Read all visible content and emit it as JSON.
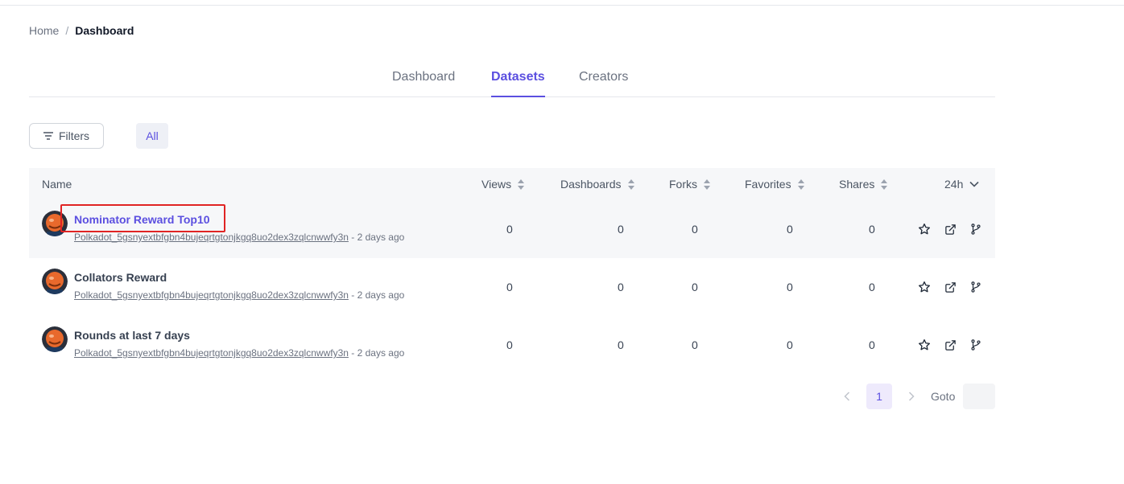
{
  "breadcrumb": {
    "home": "Home",
    "separator": "/",
    "current": "Dashboard"
  },
  "tabs": [
    {
      "label": "Dashboard",
      "active": false
    },
    {
      "label": "Datasets",
      "active": true
    },
    {
      "label": "Creators",
      "active": false
    }
  ],
  "toolbar": {
    "filters_label": "Filters",
    "all_label": "All"
  },
  "table": {
    "columns": {
      "name": "Name",
      "views": "Views",
      "dashboards": "Dashboards",
      "forks": "Forks",
      "favorites": "Favorites",
      "shares": "Shares",
      "period": "24h"
    },
    "rows": [
      {
        "title": "Nominator Reward Top10",
        "owner": "Polkadot_5gsnyextbfgbn4bujeqrtgtonjkgq8uo2dex3zqlcnwwfy3n",
        "age": " - 2 days ago",
        "views": "0",
        "dashboards": "0",
        "forks": "0",
        "favorites": "0",
        "shares": "0"
      },
      {
        "title": "Collators Reward",
        "owner": "Polkadot_5gsnyextbfgbn4bujeqrtgtonjkgq8uo2dex3zqlcnwwfy3n",
        "age": " - 2 days ago",
        "views": "0",
        "dashboards": "0",
        "forks": "0",
        "favorites": "0",
        "shares": "0"
      },
      {
        "title": "Rounds at last 7 days",
        "owner": "Polkadot_5gsnyextbfgbn4bujeqrtgtonjkgq8uo2dex3zqlcnwwfy3n",
        "age": " - 2 days ago",
        "views": "0",
        "dashboards": "0",
        "forks": "0",
        "favorites": "0",
        "shares": "0"
      }
    ]
  },
  "pagination": {
    "current_page": "1",
    "goto_label": "Goto",
    "goto_value": ""
  },
  "icons": {
    "filter": "filter-lines-icon",
    "sort": "sort-updown-icon",
    "chevron": "chevron-down-icon",
    "star": "star-icon",
    "share": "external-link-icon",
    "fork": "git-fork-icon",
    "prev": "chevron-left-icon",
    "next": "chevron-right-icon"
  },
  "colors": {
    "accent": "#5b4fe0",
    "highlight": "#e02424",
    "header_bg": "#f6f7f9"
  }
}
